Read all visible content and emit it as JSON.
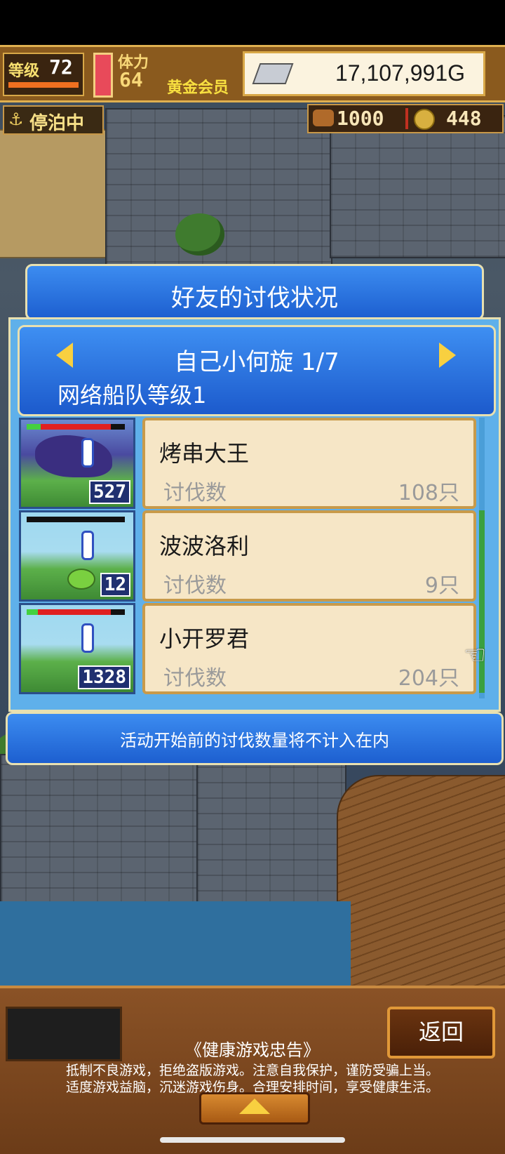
{
  "hud": {
    "level_label": "等级",
    "level_value": "72",
    "stamina_label": "体力",
    "stamina_value": "64",
    "member_label": "黄金会员",
    "gold": "17,107,991G",
    "moored_label": "停泊中",
    "wood": "1000",
    "coins": "448"
  },
  "dialog": {
    "title": "好友的讨伐状况",
    "friend_name": "自己小何旋 1/7",
    "fleet_level": "网络船队等级1",
    "rows": [
      {
        "name": "烤串大王",
        "label": "讨伐数",
        "count": "108只",
        "badge": "527",
        "hp": 0.15
      },
      {
        "name": "波波洛利",
        "label": "讨伐数",
        "count": "9只",
        "badge": "12",
        "hp": 0.0
      },
      {
        "name": "小开罗君",
        "label": "讨伐数",
        "count": "204只",
        "badge": "1328",
        "hp": 0.12
      }
    ],
    "notice": "活动开始前的讨伐数量将不计入在内"
  },
  "bottom": {
    "back_label": "返回",
    "health_title": "《健康游戏忠告》",
    "health_line1": "抵制不良游戏，拒绝盗版游戏。注意自我保护，谨防受骗上当。",
    "health_line2": "适度游戏益脑，沉迷游戏伤身。合理安排时间，享受健康生活。"
  },
  "icons": {
    "anchor": "anchor-icon",
    "barrel": "barrel-icon",
    "coin": "coin-icon",
    "silver_bar": "silver-bar-icon",
    "hand": "pointing-hand-icon"
  },
  "colors": {
    "panel_blue": "#1d5fd0",
    "card_bg": "#f6e6c6",
    "hud_brown": "#8a5a1e"
  }
}
